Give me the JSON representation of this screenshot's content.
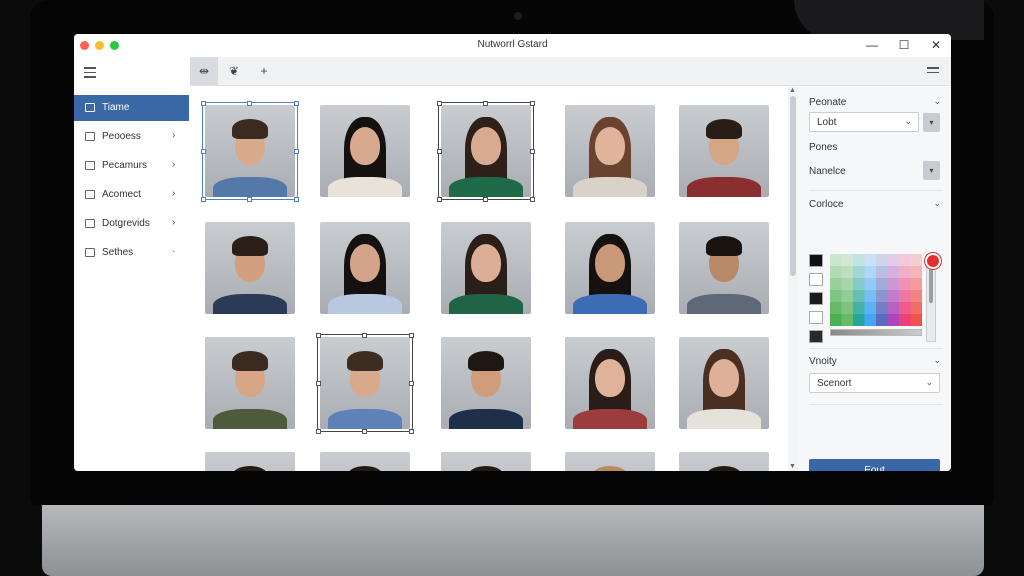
{
  "window": {
    "title": "Nutworrl Gstard",
    "controls": {
      "minimize": "—",
      "maximize": "☐",
      "close": "✕"
    }
  },
  "sidebar": {
    "items": [
      {
        "label": "Tiame",
        "icon": "grid-icon",
        "active": true,
        "chevron": ""
      },
      {
        "label": "Peooess",
        "icon": "pie-chart-icon",
        "active": false,
        "chevron": "›"
      },
      {
        "label": "Pecamurs",
        "icon": "list-icon",
        "active": false,
        "chevron": "›"
      },
      {
        "label": "Acomect",
        "icon": "document-icon",
        "active": false,
        "chevron": "›"
      },
      {
        "label": "Dotgrevids",
        "icon": "calendar-icon",
        "active": false,
        "chevron": "›"
      },
      {
        "label": "Sethes",
        "icon": "gear-icon",
        "active": false,
        "chevron": "·"
      }
    ]
  },
  "toolbar": {
    "tools": [
      {
        "icon": "adjust-icon",
        "glyph": "⇹",
        "active": true
      },
      {
        "icon": "bird-icon",
        "glyph": "❦",
        "active": false
      },
      {
        "icon": "plus-icon",
        "glyph": "+",
        "active": false
      }
    ]
  },
  "gallery": {
    "rows": [
      [
        {
          "hair": "short",
          "hair_color": "#3a2a20",
          "skin": "#d9a98b",
          "shirt": "#5478a8",
          "state": "selected"
        },
        {
          "hair": "long",
          "hair_color": "#15110f",
          "skin": "#d7a98e",
          "shirt": "#e8e2d8",
          "state": ""
        },
        {
          "hair": "long",
          "hair_color": "#2e2018",
          "skin": "#d8aa90",
          "shirt": "#1f6b48",
          "state": "boxed"
        },
        {
          "hair": "long",
          "hair_color": "#6a4230",
          "skin": "#e0b49a",
          "shirt": "#d9d2c8",
          "state": ""
        },
        {
          "hair": "short",
          "hair_color": "#2a1d16",
          "skin": "#d6a585",
          "shirt": "#8a2e30",
          "state": ""
        }
      ],
      [
        {
          "hair": "short",
          "hair_color": "#2c1f17",
          "skin": "#d2a081",
          "shirt": "#2c3b55",
          "state": ""
        },
        {
          "hair": "long",
          "hair_color": "#141110",
          "skin": "#d4a48a",
          "shirt": "#b8c8e0",
          "state": ""
        },
        {
          "hair": "long",
          "hair_color": "#2b1d17",
          "skin": "#dcae95",
          "shirt": "#1f6446",
          "state": ""
        },
        {
          "hair": "long",
          "hair_color": "#15110f",
          "skin": "#c99879",
          "shirt": "#3c6cb4",
          "state": ""
        },
        {
          "hair": "short",
          "hair_color": "#1a1411",
          "skin": "#b98a6a",
          "shirt": "#5e6878",
          "state": ""
        }
      ],
      [
        {
          "hair": "short",
          "hair_color": "#3b2a1f",
          "skin": "#d7a686",
          "shirt": "#4d5a3c",
          "state": ""
        },
        {
          "hair": "short",
          "hair_color": "#3d2c22",
          "skin": "#d8a98a",
          "shirt": "#5d82b8",
          "state": "boxed"
        },
        {
          "hair": "short",
          "hair_color": "#1e1712",
          "skin": "#cf9c7c",
          "shirt": "#1e2f4a",
          "state": ""
        },
        {
          "hair": "long",
          "hair_color": "#2a1d17",
          "skin": "#dfb39a",
          "shirt": "#9c3c3c",
          "state": ""
        },
        {
          "hair": "long",
          "hair_color": "#4a2f22",
          "skin": "#ddb097",
          "shirt": "#e5e2dc",
          "state": ""
        }
      ],
      [
        {
          "hair": "short",
          "hair_color": "#241a14",
          "skin": "#d3a182",
          "shirt": "#444",
          "state": ""
        },
        {
          "hair": "short",
          "hair_color": "#241a14",
          "skin": "#d3a182",
          "shirt": "#444",
          "state": ""
        },
        {
          "hair": "short",
          "hair_color": "#241a14",
          "skin": "#d3a182",
          "shirt": "#444",
          "state": ""
        },
        {
          "hair": "short",
          "hair_color": "#b98d5a",
          "skin": "#e0b49a",
          "shirt": "#444",
          "state": ""
        },
        {
          "hair": "short",
          "hair_color": "#241a14",
          "skin": "#d3a182",
          "shirt": "#444",
          "state": ""
        }
      ]
    ]
  },
  "panel": {
    "section1": {
      "title": "Peonate",
      "select_value": "Lobt",
      "sub_label": "Pones",
      "sub_value": "Nanelce"
    },
    "section2": {
      "title": "Corloce",
      "swatches": [
        "#111111",
        "#ffffff",
        "#1b1b1b",
        "#ffffff",
        "#2a2a2a"
      ],
      "palette_colors": [
        "#4caf50",
        "#66bb6a",
        "#26a69a",
        "#42a5f5",
        "#5c6bc0",
        "#ab47bc",
        "#ec407a",
        "#ef5350"
      ]
    },
    "section3": {
      "title": "Vnoity",
      "select_value": "Scenort"
    },
    "primary_button": "Eout"
  }
}
